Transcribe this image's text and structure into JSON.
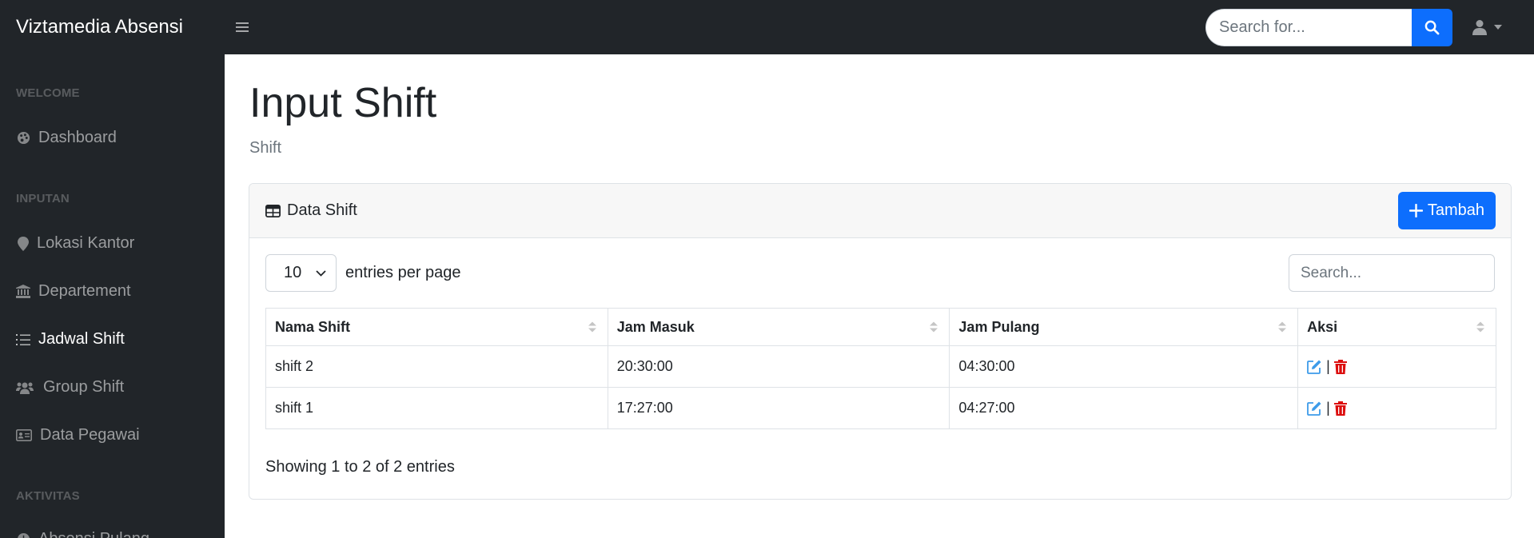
{
  "app": {
    "brand": "Viztamedia Absensi"
  },
  "topbar": {
    "search_placeholder": "Search for..."
  },
  "sidebar": {
    "sections": [
      {
        "heading": "WELCOME",
        "items": [
          {
            "label": "Dashboard",
            "icon": "palette-icon",
            "active": false
          }
        ]
      },
      {
        "heading": "INPUTAN",
        "items": [
          {
            "label": "Lokasi Kantor",
            "icon": "map-pin-icon",
            "active": false
          },
          {
            "label": "Departement",
            "icon": "bank-icon",
            "active": false
          },
          {
            "label": "Jadwal Shift",
            "icon": "list-ol-icon",
            "active": true
          },
          {
            "label": "Group Shift",
            "icon": "users-icon",
            "active": false
          },
          {
            "label": "Data Pegawai",
            "icon": "id-card-icon",
            "active": false
          }
        ]
      },
      {
        "heading": "AKTIVITAS",
        "items": [
          {
            "label": "Absensi Pulang",
            "icon": "clock-icon",
            "active": false
          }
        ]
      }
    ]
  },
  "page": {
    "title": "Input Shift",
    "breadcrumb": "Shift"
  },
  "card": {
    "title": "Data Shift",
    "add_button": "Tambah",
    "per_page_value": "10",
    "per_page_label": "entries per page",
    "search_placeholder": "Search...",
    "columns": [
      "Nama Shift",
      "Jam Masuk",
      "Jam Pulang",
      "Aksi"
    ],
    "rows": [
      {
        "nama": "shift 2",
        "masuk": "20:30:00",
        "pulang": "04:30:00"
      },
      {
        "nama": "shift 1",
        "masuk": "17:27:00",
        "pulang": "04:27:00"
      }
    ],
    "action_separator": "|",
    "info": "Showing 1 to 2 of 2 entries"
  },
  "colors": {
    "navbar": "#212529",
    "primary": "#0d6efd",
    "edit_icon": "#3d9be9",
    "delete_icon": "#dc0e0e"
  }
}
